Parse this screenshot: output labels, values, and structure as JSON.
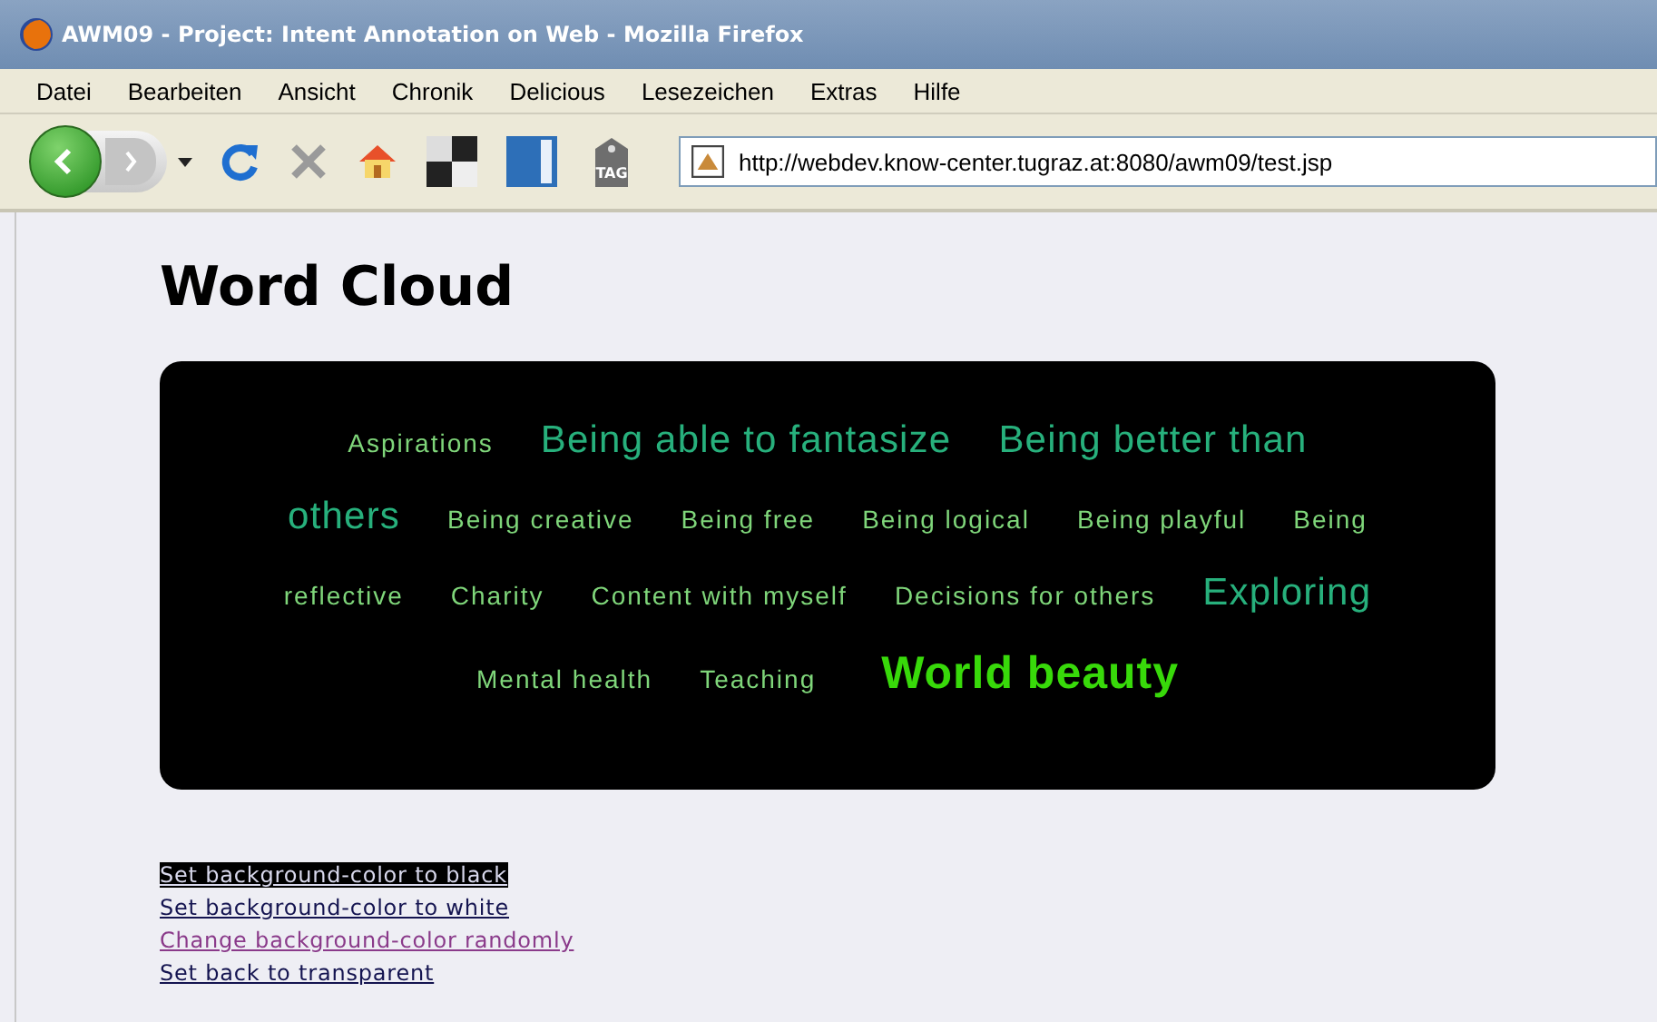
{
  "window": {
    "title": "AWM09 - Project: Intent Annotation on Web - Mozilla Firefox"
  },
  "menu": [
    "Datei",
    "Bearbeiten",
    "Ansicht",
    "Chronik",
    "Delicious",
    "Lesezeichen",
    "Extras",
    "Hilfe"
  ],
  "toolbar": {
    "address": "http://webdev.know-center.tugraz.at:8080/awm09/test.jsp",
    "tag_label": "TAG"
  },
  "heading": "Word Cloud",
  "cloud_rows": [
    {
      "words": [
        {
          "text": "Aspirations",
          "kind": "small"
        },
        {
          "text": "Being able to fantasize",
          "kind": "medium"
        },
        {
          "text": "Being better than",
          "kind": "medium"
        }
      ]
    },
    {
      "words": [
        {
          "text": "others",
          "kind": "medium"
        },
        {
          "text": "Being creative",
          "kind": "small"
        },
        {
          "text": "Being free",
          "kind": "small"
        },
        {
          "text": "Being logical",
          "kind": "small"
        },
        {
          "text": "Being playful",
          "kind": "small"
        },
        {
          "text": "Being",
          "kind": "small"
        }
      ]
    },
    {
      "words": [
        {
          "text": "reflective",
          "kind": "small"
        },
        {
          "text": "Charity",
          "kind": "small"
        },
        {
          "text": "Content with myself",
          "kind": "small"
        },
        {
          "text": "Decisions for others",
          "kind": "small"
        },
        {
          "text": "Exploring",
          "kind": "medium"
        }
      ]
    },
    {
      "words": [
        {
          "text": "Mental health",
          "kind": "small"
        },
        {
          "text": "Teaching",
          "kind": "small"
        },
        {
          "text": "World beauty",
          "kind": "large"
        }
      ]
    }
  ],
  "links": [
    {
      "text": "Set background-color to black",
      "kind": "highlighted"
    },
    {
      "text": "Set background-color to white",
      "kind": "plain"
    },
    {
      "text": "Change background-color randomly",
      "kind": "visited"
    },
    {
      "text": "Set back to transparent",
      "kind": "plain"
    }
  ]
}
